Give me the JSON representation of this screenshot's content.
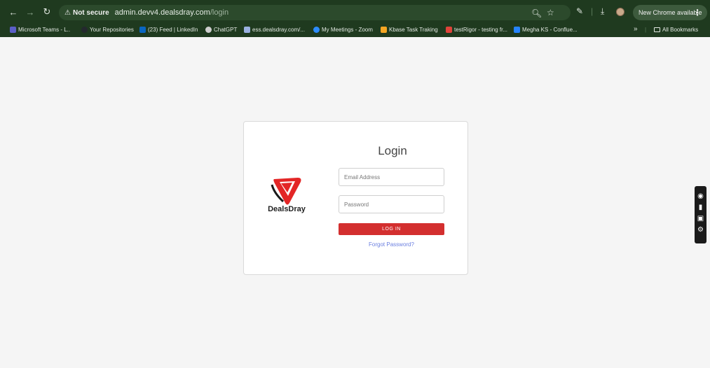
{
  "browser": {
    "security_label": "Not secure",
    "url_host": "admin.devv4.dealsdray.com",
    "url_path": "/login",
    "update_label": "New Chrome available"
  },
  "bookmarks": [
    {
      "label": "Microsoft Teams - L..",
      "color": "#5b5fc7"
    },
    {
      "label": "Your Repositories",
      "color": "#24292e"
    },
    {
      "label": "(23) Feed | LinkedIn",
      "color": "#0a66c2"
    },
    {
      "label": "ChatGPT",
      "color": "#cfcfcf"
    },
    {
      "label": "ess.dealsdray.com/...",
      "color": "#9ab0e0"
    },
    {
      "label": "My Meetings - Zoom",
      "color": "#2d8cff"
    },
    {
      "label": "Kbase Task Traking",
      "color": "#f5a623"
    },
    {
      "label": "testRigor - testing fr...",
      "color": "#e0433a"
    },
    {
      "label": "Megha KS - Conflue...",
      "color": "#2684ff"
    }
  ],
  "bookmarks_overflow": "»",
  "all_bookmarks": "All Bookmarks",
  "login": {
    "title": "Login",
    "brand": "DealsDray",
    "email_placeholder": "Email Address",
    "password_placeholder": "Password",
    "submit_label": "LOG IN",
    "forgot_label": "Forgot Password?"
  },
  "colors": {
    "toolbar_bg": "#1f3a1f",
    "primary_button": "#d32f2f",
    "link": "#6b7fe0"
  }
}
